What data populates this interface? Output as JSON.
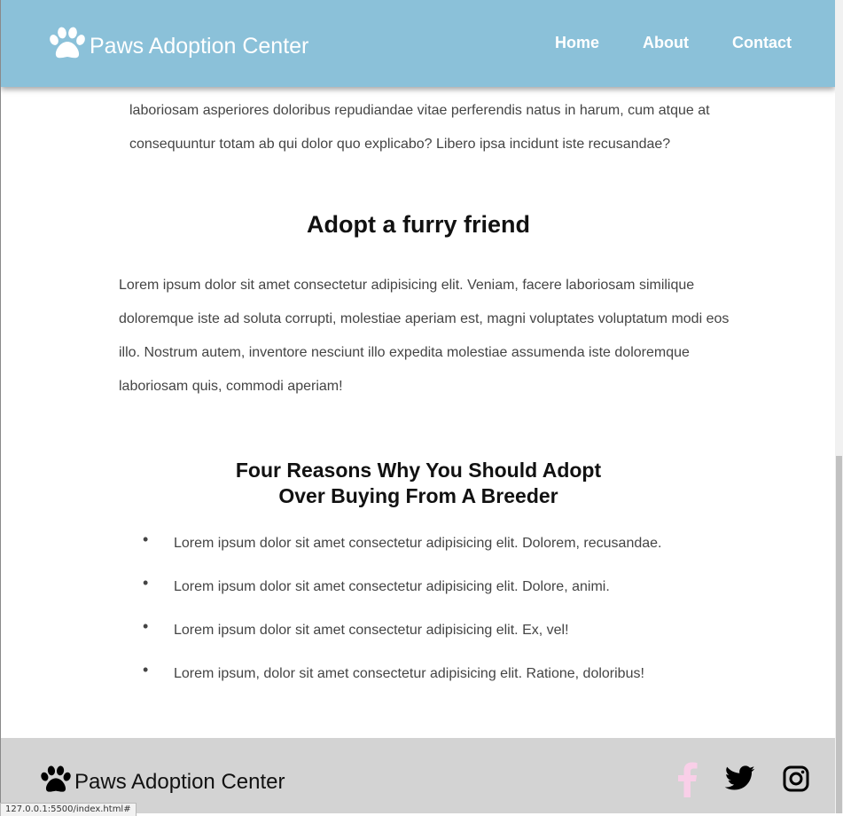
{
  "header": {
    "brand": "Paws Adoption Center",
    "nav": [
      "Home",
      "About",
      "Contact"
    ]
  },
  "intro": {
    "text": "laboriosam asperiores doloribus repudiandae vitae perferendis natus in harum, cum atque at consequuntur totam ab qui dolor quo explicabo? Libero ipsa incidunt iste recusandae?"
  },
  "adopt": {
    "heading": "Adopt a furry friend",
    "text": "Lorem ipsum dolor sit amet consectetur adipisicing elit. Veniam, facere laboriosam similique doloremque iste ad soluta corrupti, molestiae aperiam est, magni voluptates voluptatum modi eos illo. Nostrum autem, inventore nesciunt illo expedita molestiae assumenda iste doloremque laboriosam quis, commodi aperiam!"
  },
  "reasons": {
    "heading_line1": "Four Reasons Why You Should Adopt",
    "heading_line2": "Over Buying From A Breeder",
    "bullet": "•",
    "items": [
      "Lorem ipsum dolor sit amet consectetur adipisicing elit. Dolorem, recusandae.",
      "Lorem ipsum dolor sit amet consectetur adipisicing elit. Dolore, animi.",
      "Lorem ipsum dolor sit amet consectetur adipisicing elit. Ex, vel!",
      "Lorem ipsum, dolor sit amet consectetur adipisicing elit. Ratione, doloribus!"
    ]
  },
  "footer": {
    "brand": "Paws Adoption Center",
    "social_icons": [
      "facebook-icon",
      "twitter-icon",
      "instagram-icon"
    ]
  },
  "status_bar": {
    "url": "127.0.0.1:5500/index.html#"
  },
  "colors": {
    "header_bg": "#8bc1d9",
    "footer_bg": "#d3d3d3",
    "facebook": "#f9cfe8",
    "twitter": "#000000",
    "instagram": "#000000",
    "body_text": "#444444",
    "heading_text": "#111111"
  }
}
